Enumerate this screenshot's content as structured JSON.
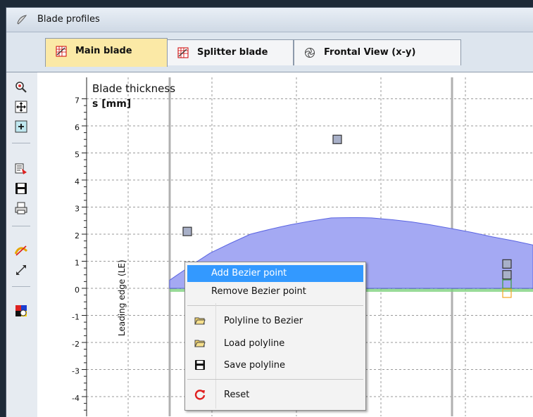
{
  "window": {
    "title": "Blade profiles",
    "icon": "blade-app-icon"
  },
  "tabs": [
    {
      "label": "Main blade",
      "icon": "grid-icon",
      "active": true
    },
    {
      "label": "Splitter blade",
      "icon": "grid-icon",
      "active": false
    },
    {
      "label": "Frontal View (x-y)",
      "icon": "spiral-icon",
      "active": false
    }
  ],
  "toolbar": [
    {
      "icon": "zoom-icon"
    },
    {
      "icon": "pan-icon"
    },
    {
      "icon": "zoom-fit-icon"
    },
    {
      "icon": "export-icon"
    },
    {
      "icon": "save-icon"
    },
    {
      "icon": "print-icon"
    },
    {
      "icon": "edit-curve-icon"
    },
    {
      "icon": "resize-icon"
    },
    {
      "icon": "color-palette-icon"
    }
  ],
  "plot": {
    "title": "Blade thickness",
    "y_unit_label": "s [mm]",
    "leading_edge_label": "Leading edge (LE)",
    "y_ticks": [
      "7",
      "6",
      "5",
      "4",
      "3",
      "2",
      "1",
      "0",
      "-1",
      "-2",
      "-3",
      "-4"
    ],
    "colors": {
      "fill": "#a4a9f3",
      "curve": "#5a64e2",
      "handle": "#a8b0c8",
      "green": "#7fd27f",
      "orange": "#f5a623"
    }
  },
  "chart_data": {
    "type": "area",
    "title": "Blade thickness",
    "ylabel": "s [mm]",
    "ylim": [
      -4.5,
      7.5
    ],
    "grid": true,
    "series": [
      {
        "values": [
          0.3,
          1.3,
          2.0,
          2.35,
          2.6,
          2.6,
          2.45,
          2.2,
          1.9,
          1.6
        ]
      }
    ],
    "bezier_points_y": [
      2.1,
      5.5,
      0.9,
      0.5
    ]
  },
  "context_menu": {
    "items": [
      {
        "label": "Add Bezier point",
        "highlighted": true
      },
      {
        "label": "Remove Bezier point"
      },
      {
        "label": "Polyline to Bezier",
        "icon": "folder-open-icon"
      },
      {
        "label": "Load polyline",
        "icon": "folder-open-icon"
      },
      {
        "label": "Save polyline",
        "icon": "save-icon"
      },
      {
        "label": "Reset",
        "icon": "reset-icon"
      }
    ]
  }
}
